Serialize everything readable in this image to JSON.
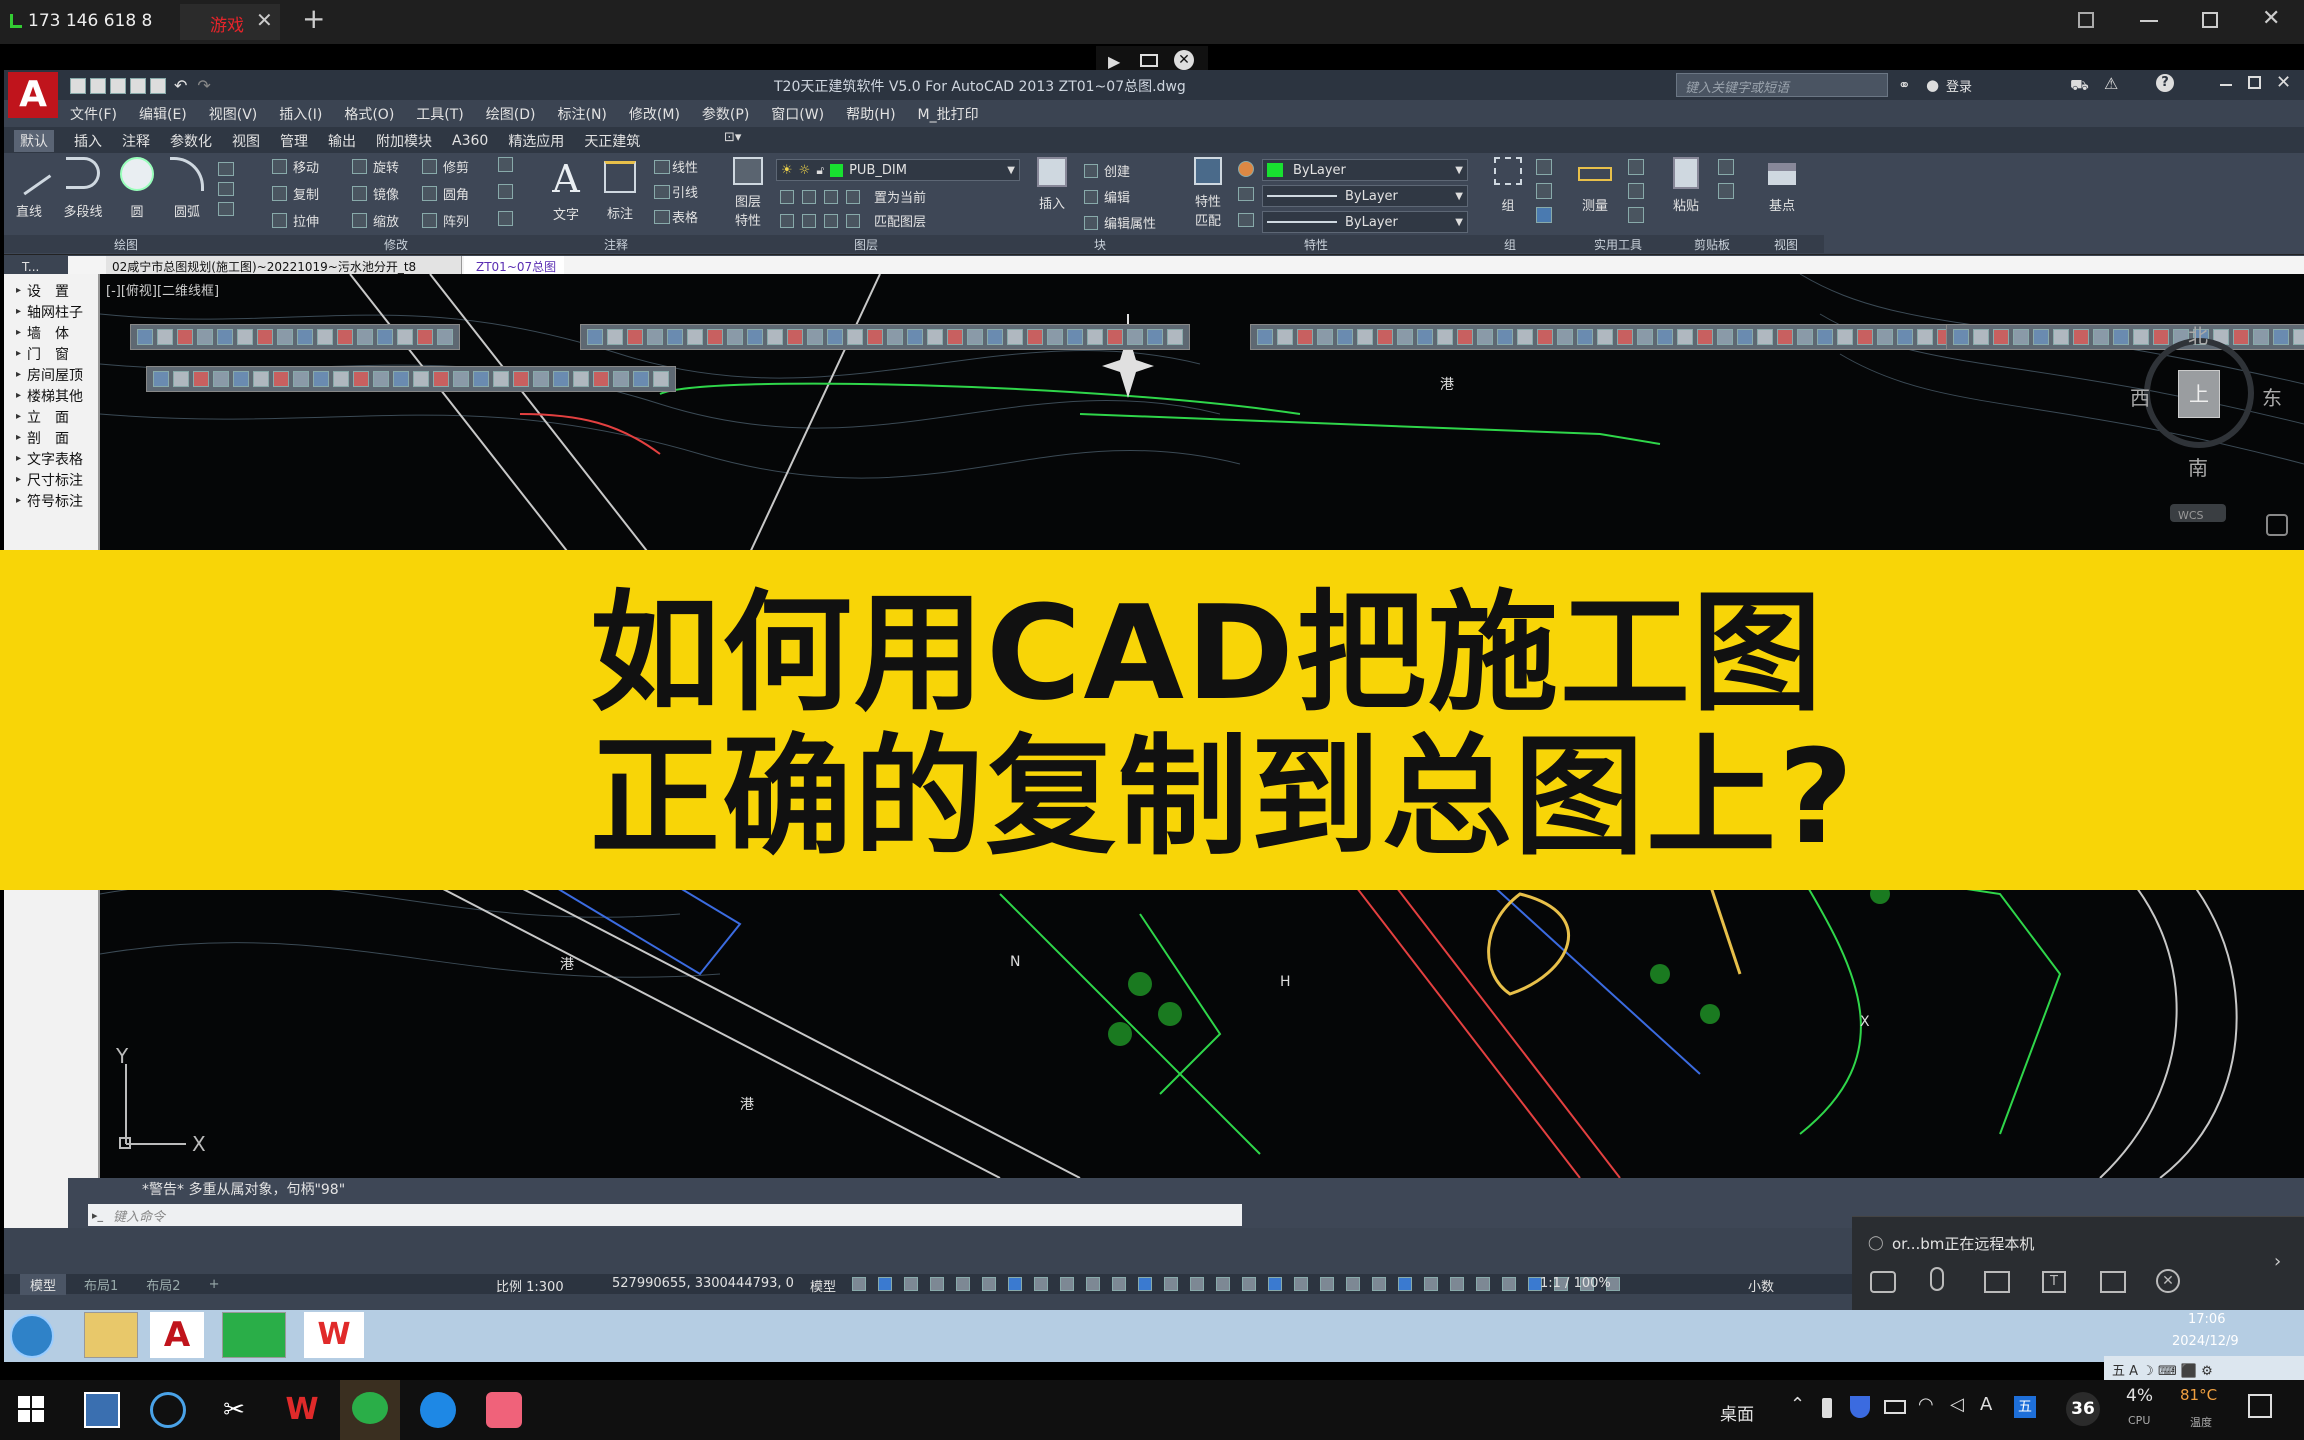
{
  "remote_bar": {
    "signal": "173 146 618 8",
    "tab": "游戏",
    "close": "✕",
    "add": "+"
  },
  "cad": {
    "title": "T20天正建筑软件 V5.0 For AutoCAD 2013   ZT01~07总图.dwg",
    "search_placeholder": "键入关键字或短语",
    "login": "登录",
    "menus": [
      "文件(F)",
      "编辑(E)",
      "视图(V)",
      "插入(I)",
      "格式(O)",
      "工具(T)",
      "绘图(D)",
      "标注(N)",
      "修改(M)",
      "参数(P)",
      "窗口(W)",
      "帮助(H)",
      "M_批打印"
    ],
    "ribbon_tabs": [
      "默认",
      "插入",
      "注释",
      "参数化",
      "视图",
      "管理",
      "输出",
      "附加模块",
      "A360",
      "精选应用",
      "天正建筑"
    ],
    "draw_tools": [
      "直线",
      "多段线",
      "圆",
      "圆弧"
    ],
    "modify_tools": [
      [
        "移动",
        "旋转",
        "修剪"
      ],
      [
        "复制",
        "镜像",
        "圆角"
      ],
      [
        "拉伸",
        "缩放",
        "阵列"
      ]
    ],
    "annot_tools": [
      "文字",
      "标注"
    ],
    "annot_small": [
      "线性",
      "引线",
      "表格"
    ],
    "layer_name": "PUB_DIM",
    "layer_small": [
      "置为当前",
      "匹配图层"
    ],
    "layer_tools": [
      "图层",
      "特性"
    ],
    "block_tools": [
      "插入",
      "创建",
      "编辑",
      "编辑属性"
    ],
    "prop_labels": [
      "特性",
      "匹配"
    ],
    "bylayer": [
      "ByLayer",
      "ByLayer",
      "ByLayer"
    ],
    "group_label": "组",
    "util_label": "测量",
    "clip_label": "粘贴",
    "view_label": "基点",
    "panel_labels": [
      "绘图",
      "修改",
      "注释",
      "图层",
      "块",
      "特性",
      "组",
      "实用工具",
      "剪贴板",
      "视图"
    ],
    "doc_tabs": [
      "02咸宁市总图规划(施工图)~20221019~污水池分开_t8",
      "ZT01~07总图"
    ],
    "left_head": "T...",
    "left_items": [
      "设　置",
      "轴网柱子",
      "墙　体",
      "门　窗",
      "房间屋顶",
      "楼梯其他",
      "立　面",
      "剖　面",
      "文字表格",
      "尺寸标注",
      "符号标注"
    ],
    "viewport_label": "[-][俯视][二维线框]",
    "compass": {
      "n": "北",
      "s": "南",
      "e": "东",
      "w": "西",
      "top": "上",
      "wcs": "WCS"
    },
    "cmd_history": "*警告* 多重从属对象，句柄\"98\"",
    "cmd_placeholder": "键入命令",
    "layout_tabs": [
      "模型",
      "布局1",
      "布局2",
      "+"
    ],
    "status": {
      "scale": "比例 1:300",
      "coords": "527990655, 3300444793, 0",
      "model": "模型",
      "anno": "1:1 / 100%",
      "units": "小数"
    },
    "plan_text": [
      "港",
      "港",
      "X",
      "N",
      "N",
      "港",
      "H"
    ]
  },
  "banner": {
    "line1": "如何用CAD把施工图",
    "line2": "正确的复制到总图上?"
  },
  "remote_popup": {
    "text": "or...bm正在远程本机"
  },
  "inner_taskbar": {
    "time": "17:06",
    "date": "2024/12/9"
  },
  "taskbar": {
    "desktop": "桌面",
    "cpu_val": "4%",
    "cpu_label": "CPU",
    "temp_val": "81°C",
    "temp_label": "温度",
    "badge": "36"
  }
}
